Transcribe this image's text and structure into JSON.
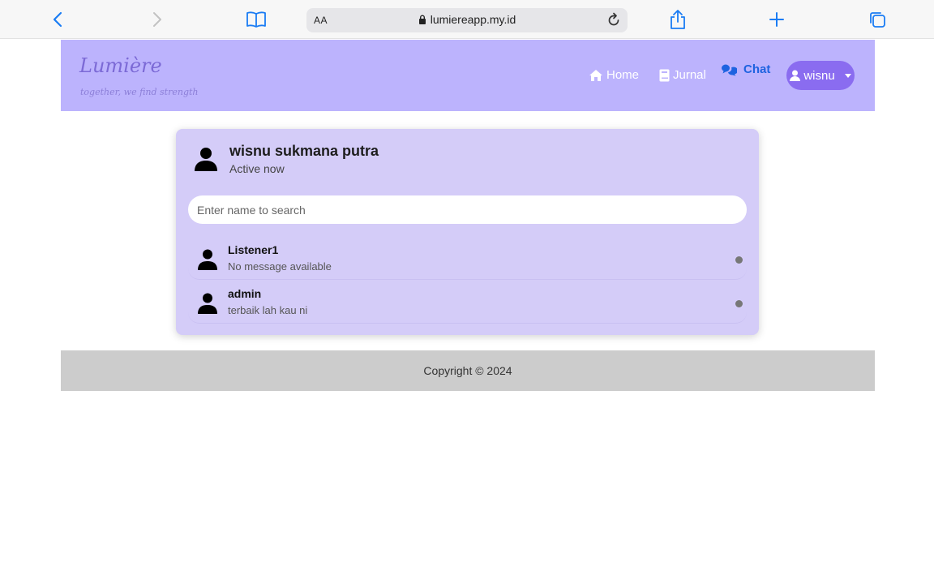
{
  "browser": {
    "text_size_label": "AA",
    "url": "lumiereapp.my.id",
    "icons": [
      "back-icon",
      "forward-icon",
      "bookmarks-icon",
      "lock-icon",
      "reload-icon",
      "share-icon",
      "new-tab-icon",
      "tabs-icon"
    ]
  },
  "header": {
    "brand": "Lumière",
    "tagline": "together, we find strength",
    "nav": [
      {
        "label": "Home",
        "icon": "home-icon"
      },
      {
        "label": "Jurnal",
        "icon": "book-icon"
      },
      {
        "label": "Chat",
        "icon": "chat-icon",
        "active": true
      }
    ],
    "user_menu": {
      "label": "wisnu",
      "icon": "user-icon"
    }
  },
  "chat": {
    "current_user": {
      "name": "wisnu sukmana putra",
      "status": "Active now"
    },
    "search": {
      "placeholder": "Enter name to search",
      "value": ""
    },
    "users": [
      {
        "name": "Listener1",
        "last_message": "No message available",
        "status": "offline"
      },
      {
        "name": "admin",
        "last_message": "terbaik lah kau ni",
        "status": "offline"
      }
    ]
  },
  "footer": {
    "text": "Copyright © 2024"
  },
  "colors": {
    "header_bg": "#bcb3fd",
    "card_bg": "#d4ccf8",
    "user_pill": "#8a6cf0",
    "active_nav": "#1e63e0",
    "status_offline": "#777777",
    "footer_bg": "#cccccc"
  }
}
